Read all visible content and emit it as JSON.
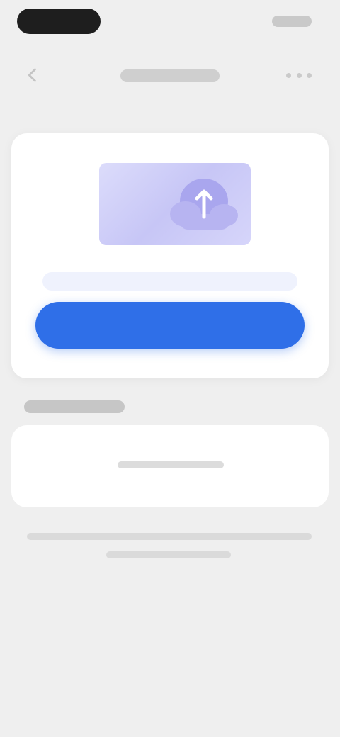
{
  "status_bar": {
    "time": "",
    "indicators": ""
  },
  "nav": {
    "title": "",
    "back_icon": "chevron-left-icon",
    "more_icon": "more-horizontal-icon"
  },
  "upload_card": {
    "illustration_icon": "cloud-upload-icon",
    "hint": "",
    "button_label": "",
    "colors": {
      "button": "#2f6fe8",
      "illustration": "#c7c6f6",
      "hint_background": "#eff2fd"
    }
  },
  "section": {
    "title": "",
    "empty_text": ""
  },
  "footnote": "",
  "colors": {
    "background": "#efefef",
    "card": "#ffffff"
  }
}
